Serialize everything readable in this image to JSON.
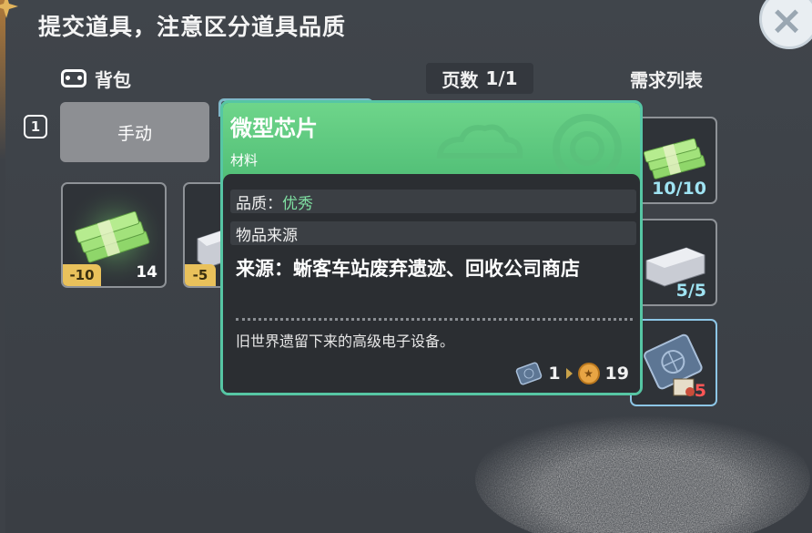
{
  "dialog": {
    "title": "提交道具，注意区分道具品质",
    "close_symbol": "×"
  },
  "backpack": {
    "label": "背包",
    "icon": "backpack-icon",
    "page_label": "页数",
    "page_value": "1/1"
  },
  "requirements": {
    "label": "需求列表",
    "slots": [
      {
        "item": "cash-bundle-icon",
        "count": "10/10",
        "state": "complete"
      },
      {
        "item": "metal-ingot-icon",
        "count": "5/5",
        "state": "complete"
      },
      {
        "item": "microchip-icon",
        "count": "5",
        "state": "missing"
      }
    ]
  },
  "controls": {
    "badge_number": "1",
    "manual_button": "手动"
  },
  "inventory": [
    {
      "item": "cash-bundle-icon",
      "minus": "-10",
      "qty": "14"
    },
    {
      "item": "metal-ingot-icon",
      "minus": "-5",
      "qty": ""
    },
    {
      "item": "microchip-icon",
      "minus": "",
      "qty": ""
    }
  ],
  "tooltip": {
    "name": "微型芯片",
    "type": "材料",
    "quality_label": "品质：",
    "quality_value": "优秀",
    "source_header": "物品来源",
    "source_text": "来源：蜥客车站废弃遗迹、回收公司商店",
    "description": "旧世界遗留下来的高级电子设备。",
    "footer_count": "1",
    "footer_price": "19"
  },
  "colors": {
    "tooltip_header": "#5ccb7d",
    "tooltip_border": "#56c6a4",
    "quality_good": "#7fe0a2",
    "count_complete": "#9fe3f2",
    "count_missing": "#ff5656",
    "minus_badge": "#e9c15b"
  }
}
